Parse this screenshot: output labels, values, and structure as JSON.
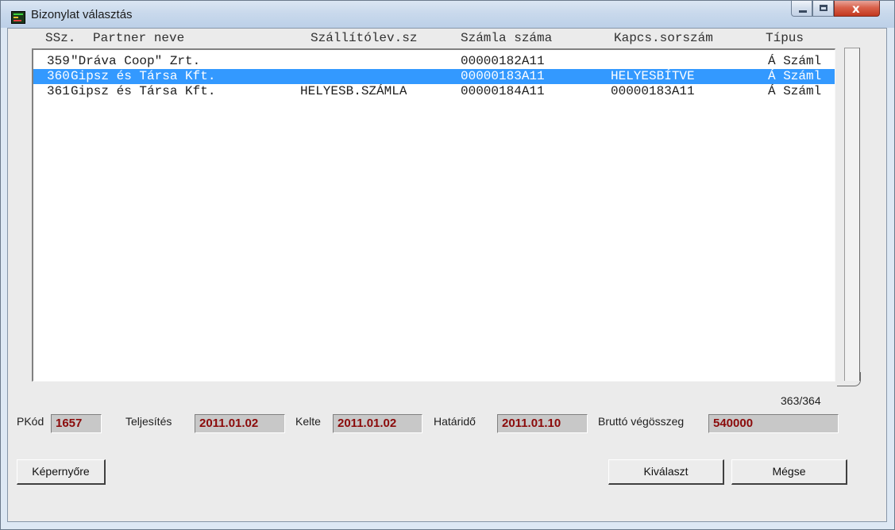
{
  "window": {
    "title": "Bizonylat választás",
    "close_glyph": "x"
  },
  "columns": {
    "ssz": "SSz.",
    "partner": "Partner neve",
    "szallito": "Szállítólev.sz",
    "szamla": "Számla száma",
    "kapcs": "Kapcs.sorszám",
    "tipus": "Típus"
  },
  "rows": [
    {
      "ssz": "359",
      "partner": "\"Dráva Coop\" Zrt.",
      "szallito": "",
      "szamla": "00000182A11",
      "kapcs": "",
      "tipus": "Á Száml",
      "selected": false
    },
    {
      "ssz": "360",
      "partner": "Gipsz és Társa Kft.",
      "szallito": "",
      "szamla": "00000183A11",
      "kapcs": "HELYESBÍTVE",
      "tipus": "Á Száml",
      "selected": true
    },
    {
      "ssz": "361",
      "partner": "Gipsz és Társa Kft.",
      "szallito": "HELYESB.SZÁMLA",
      "szamla": "00000184A11",
      "kapcs": "00000183A11",
      "tipus": "Á Száml",
      "selected": false
    }
  ],
  "counter": "363/364",
  "fields": {
    "pkod_label": "PKód",
    "pkod_value": "1657",
    "teljesites_label": "Teljesítés",
    "teljesites_value": "2011.01.02",
    "kelte_label": "Kelte",
    "kelte_value": "2011.01.02",
    "hatarido_label": "Határidő",
    "hatarido_value": "2011.01.10",
    "brutto_label": "Bruttó végösszeg",
    "brutto_value": "540000"
  },
  "buttons": {
    "kepernyore": "Képernyőre",
    "kivalaszt": "Kiválaszt",
    "megse": "Mégse"
  },
  "colors": {
    "selection": "#3399ff",
    "field_value": "#8b0a0a"
  }
}
